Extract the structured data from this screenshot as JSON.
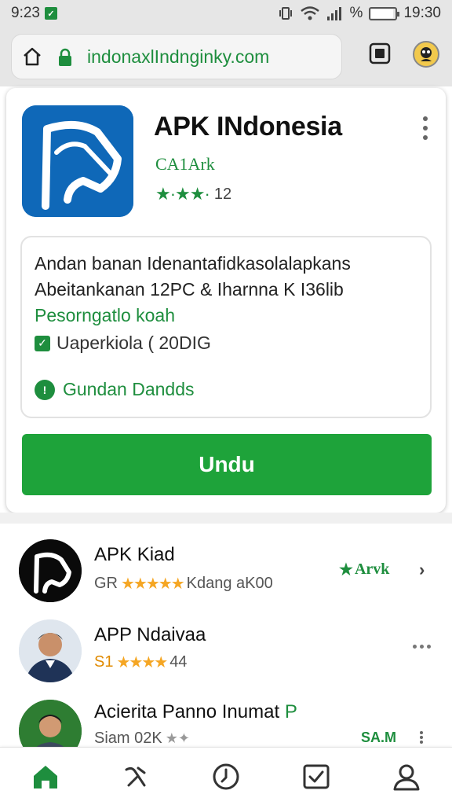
{
  "status_bar": {
    "time": "9:23",
    "percent_sign": "%",
    "clock": "19:30"
  },
  "browser": {
    "url": "indonaxlIndnginky.com"
  },
  "app": {
    "title": "APK INdonesia",
    "developer": "CA1Ark",
    "rating_count": "12",
    "details": {
      "line1": "Andan banan Idenantafidkasolalapkans",
      "line2": "Abeitankanan 12PC & Iharnna K I36lib",
      "green_line": "Pesorngatlo koah",
      "check_label": "Uaperkiola ( 20DIG",
      "link_label": "Gundan Dandds"
    },
    "download_label": "Undu"
  },
  "list": [
    {
      "name": "APK Kiad",
      "sub_prefix": "GR",
      "sub_suffix": "Kdang aK00",
      "right_label": "Arvk"
    },
    {
      "name": "APP Ndaivaa",
      "sub_prefix": "S1",
      "sub_suffix": "44"
    },
    {
      "name": "Acierita Panno Inumat",
      "name_green": "P",
      "sub_prefix": "Siam 02K",
      "right_label": "SA.M"
    }
  ],
  "colors": {
    "accent_green": "#1e8e3e",
    "button_green": "#1ea33a",
    "logo_blue": "#0f68b8",
    "star_orange": "#f5a623"
  },
  "icons": [
    "home-icon",
    "lock-icon",
    "tab-switcher-icon",
    "avatar",
    "more-vert-icon",
    "check-icon",
    "info-icon",
    "chevron-right-icon",
    "more-horiz-icon",
    "tools-icon",
    "history-icon",
    "tasks-icon",
    "profile-icon"
  ]
}
